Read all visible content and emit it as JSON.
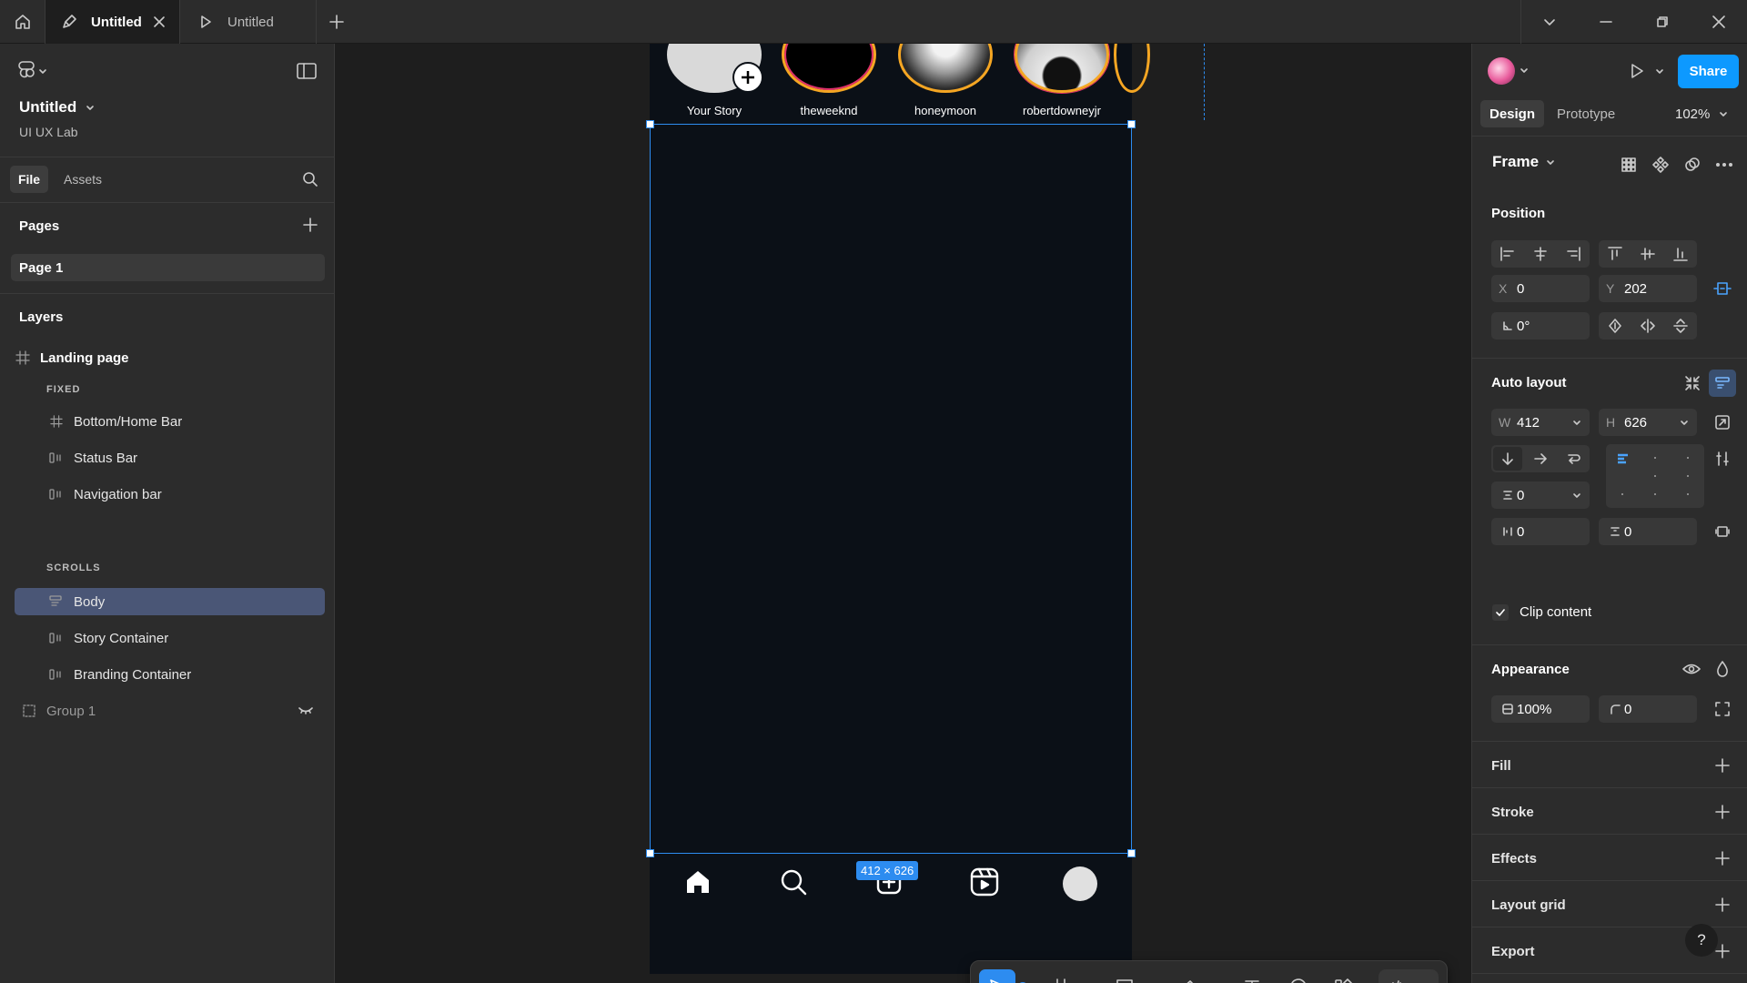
{
  "titlebar": {
    "tabs": [
      {
        "label": "Untitled",
        "icon": "pen-file-icon",
        "active": true
      },
      {
        "label": "Untitled",
        "icon": "play-file-icon",
        "active": false
      }
    ]
  },
  "left_panel": {
    "file_name": "Untitled",
    "team_name": "UI UX Lab",
    "file_tab": "File",
    "assets_tab": "Assets",
    "pages_title": "Pages",
    "pages": [
      "Page 1"
    ],
    "layers_title": "Layers",
    "layers": {
      "root": "Landing page",
      "fixed_label": "FIXED",
      "fixed": [
        "Bottom/Home Bar",
        "Status Bar",
        "Navigation bar"
      ],
      "scrolls_label": "SCROLLS",
      "scrolls": [
        "Body",
        "Story Container",
        "Branding Container"
      ],
      "group": "Group 1"
    }
  },
  "canvas": {
    "stories": [
      {
        "name": "Your Story"
      },
      {
        "name": "theweeknd"
      },
      {
        "name": "honeymoon"
      },
      {
        "name": "robertdowneyjr"
      }
    ],
    "selection_size": "412 × 626",
    "frame_color": "#0b1017",
    "selection_color": "#2d8cf0"
  },
  "right_panel": {
    "share_label": "Share",
    "design_tab": "Design",
    "prototype_tab": "Prototype",
    "zoom": "102%",
    "frame_type": "Frame",
    "position": {
      "title": "Position",
      "x_label": "X",
      "x": "0",
      "y_label": "Y",
      "y": "202",
      "rotation": "0°"
    },
    "auto_layout": {
      "title": "Auto layout",
      "w_label": "W",
      "w": "412",
      "h_label": "H",
      "h": "626",
      "gap": "0",
      "padding_h": "0",
      "padding_v": "0",
      "clip_content": "Clip content"
    },
    "appearance": {
      "title": "Appearance",
      "opacity": "100%",
      "radius": "0"
    },
    "sections": [
      "Fill",
      "Stroke",
      "Effects",
      "Layout grid",
      "Export"
    ],
    "help": "?",
    "accent": "#0d99ff"
  }
}
